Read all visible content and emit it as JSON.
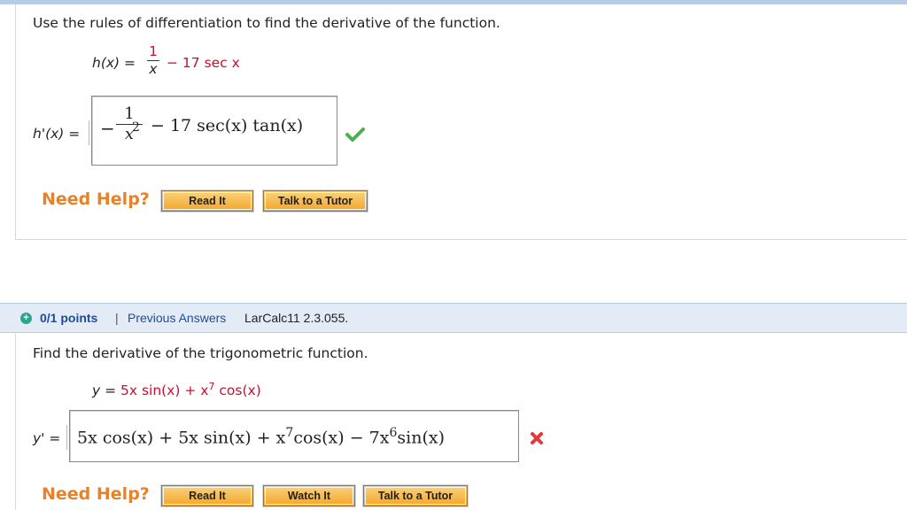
{
  "q1": {
    "instruction": "Use the rules of differentiation to find the derivative of the function.",
    "function_lhs": "h(x) = ",
    "frac_num": "1",
    "frac_den": "x",
    "function_rest": "− 17 sec x",
    "answer_label": "h'(x) = ",
    "answer_frac_num": "1",
    "answer_frac_den": "x",
    "answer_frac_exp": "2",
    "answer_rest": "− 17 sec(x) tan(x)",
    "answer_sign": "−",
    "status": "correct",
    "status_icon": "check-icon",
    "need_help": "Need Help?",
    "buttons": [
      "Read It",
      "Talk to a Tutor"
    ]
  },
  "q2": {
    "points": "0/1 points",
    "separator": "|",
    "previous_answers": "Previous Answers",
    "reference": "LarCalc11 2.3.055.",
    "instruction": "Find the derivative of the trigonometric function.",
    "function_lhs": "y = ",
    "function_p1": "5x sin(x) + x",
    "function_exp": "7",
    "function_p2": " cos(x)",
    "answer_label": "y' = ",
    "answer_p1": "5x cos(x) + 5x sin(x) + x",
    "answer_exp1": "7",
    "answer_p2": "cos(x) − 7x",
    "answer_exp2": "6",
    "answer_p3": "sin(x)",
    "status": "incorrect",
    "status_icon": "x-icon",
    "need_help": "Need Help?",
    "buttons": [
      "Read It",
      "Watch It",
      "Talk to a Tutor"
    ]
  },
  "colors": {
    "accent_orange": "#e8822a",
    "link_blue": "#1c4d9c",
    "correct_green": "#4caf50",
    "incorrect_red": "#e03a3a",
    "math_red": "#c8102e"
  }
}
